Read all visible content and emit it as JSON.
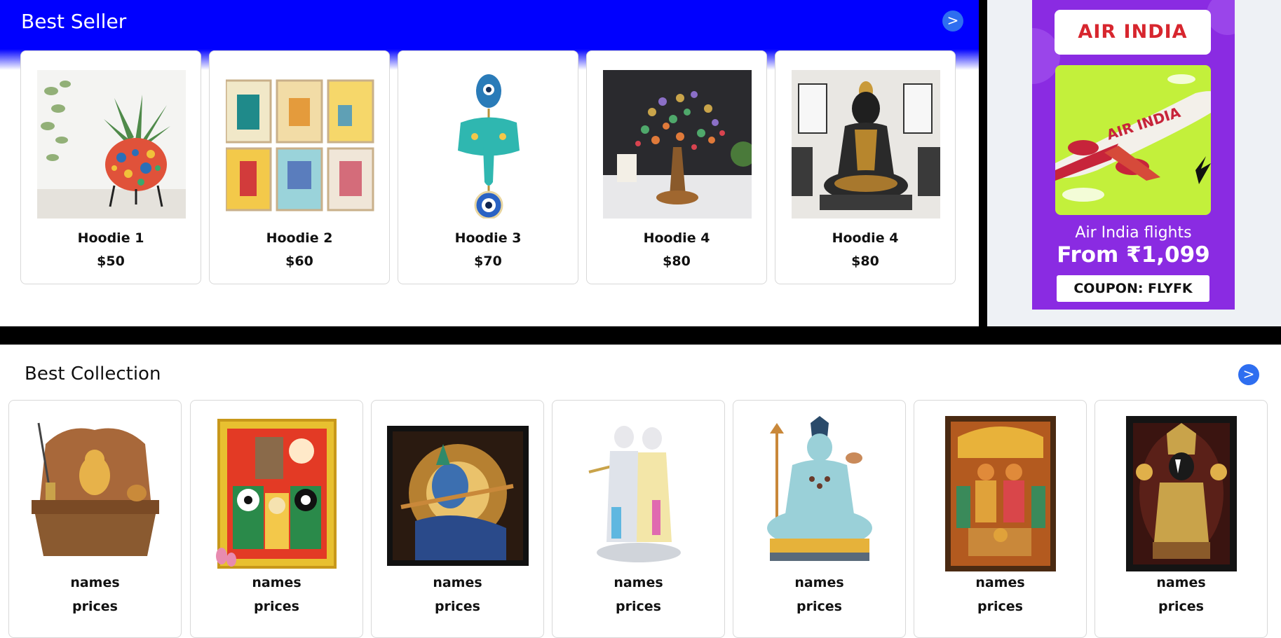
{
  "best_seller": {
    "title": "Best Seller",
    "next_label": ">",
    "products": [
      {
        "name": "Hoodie 1",
        "price": "$50",
        "image": "succulent-planter"
      },
      {
        "name": "Hoodie 2",
        "price": "$60",
        "image": "wall-art-prints"
      },
      {
        "name": "Hoodie 3",
        "price": "$70",
        "image": "evil-eye-elephant-hanging"
      },
      {
        "name": "Hoodie 4",
        "price": "$80",
        "image": "gemstone-tree"
      },
      {
        "name": "Hoodie 4",
        "price": "$80",
        "image": "buddha-statue"
      }
    ]
  },
  "ad": {
    "brand": "AIR INDIA",
    "plane_text": "AIR INDIA",
    "line1": "Air India flights",
    "line2": "From ₹1,099",
    "coupon": "COUPON: FLYFK",
    "colors": {
      "background": "#8a2be2",
      "panel": "#c3f03b",
      "brand": "#d7262e"
    }
  },
  "best_collection": {
    "title": "Best Collection",
    "next_label": ">",
    "products": [
      {
        "name": "names",
        "price": "prices",
        "image": "ganesha-mandir"
      },
      {
        "name": "names",
        "price": "prices",
        "image": "jagannath-frame"
      },
      {
        "name": "names",
        "price": "prices",
        "image": "krishna-painting"
      },
      {
        "name": "names",
        "price": "prices",
        "image": "radha-krishna-idol"
      },
      {
        "name": "names",
        "price": "prices",
        "image": "shiva-statue"
      },
      {
        "name": "names",
        "price": "prices",
        "image": "ram-darbar-frame"
      },
      {
        "name": "names",
        "price": "prices",
        "image": "balaji-frame"
      }
    ]
  },
  "colors": {
    "header_blue": "#0000ff",
    "button_blue": "#2e6ef0"
  }
}
